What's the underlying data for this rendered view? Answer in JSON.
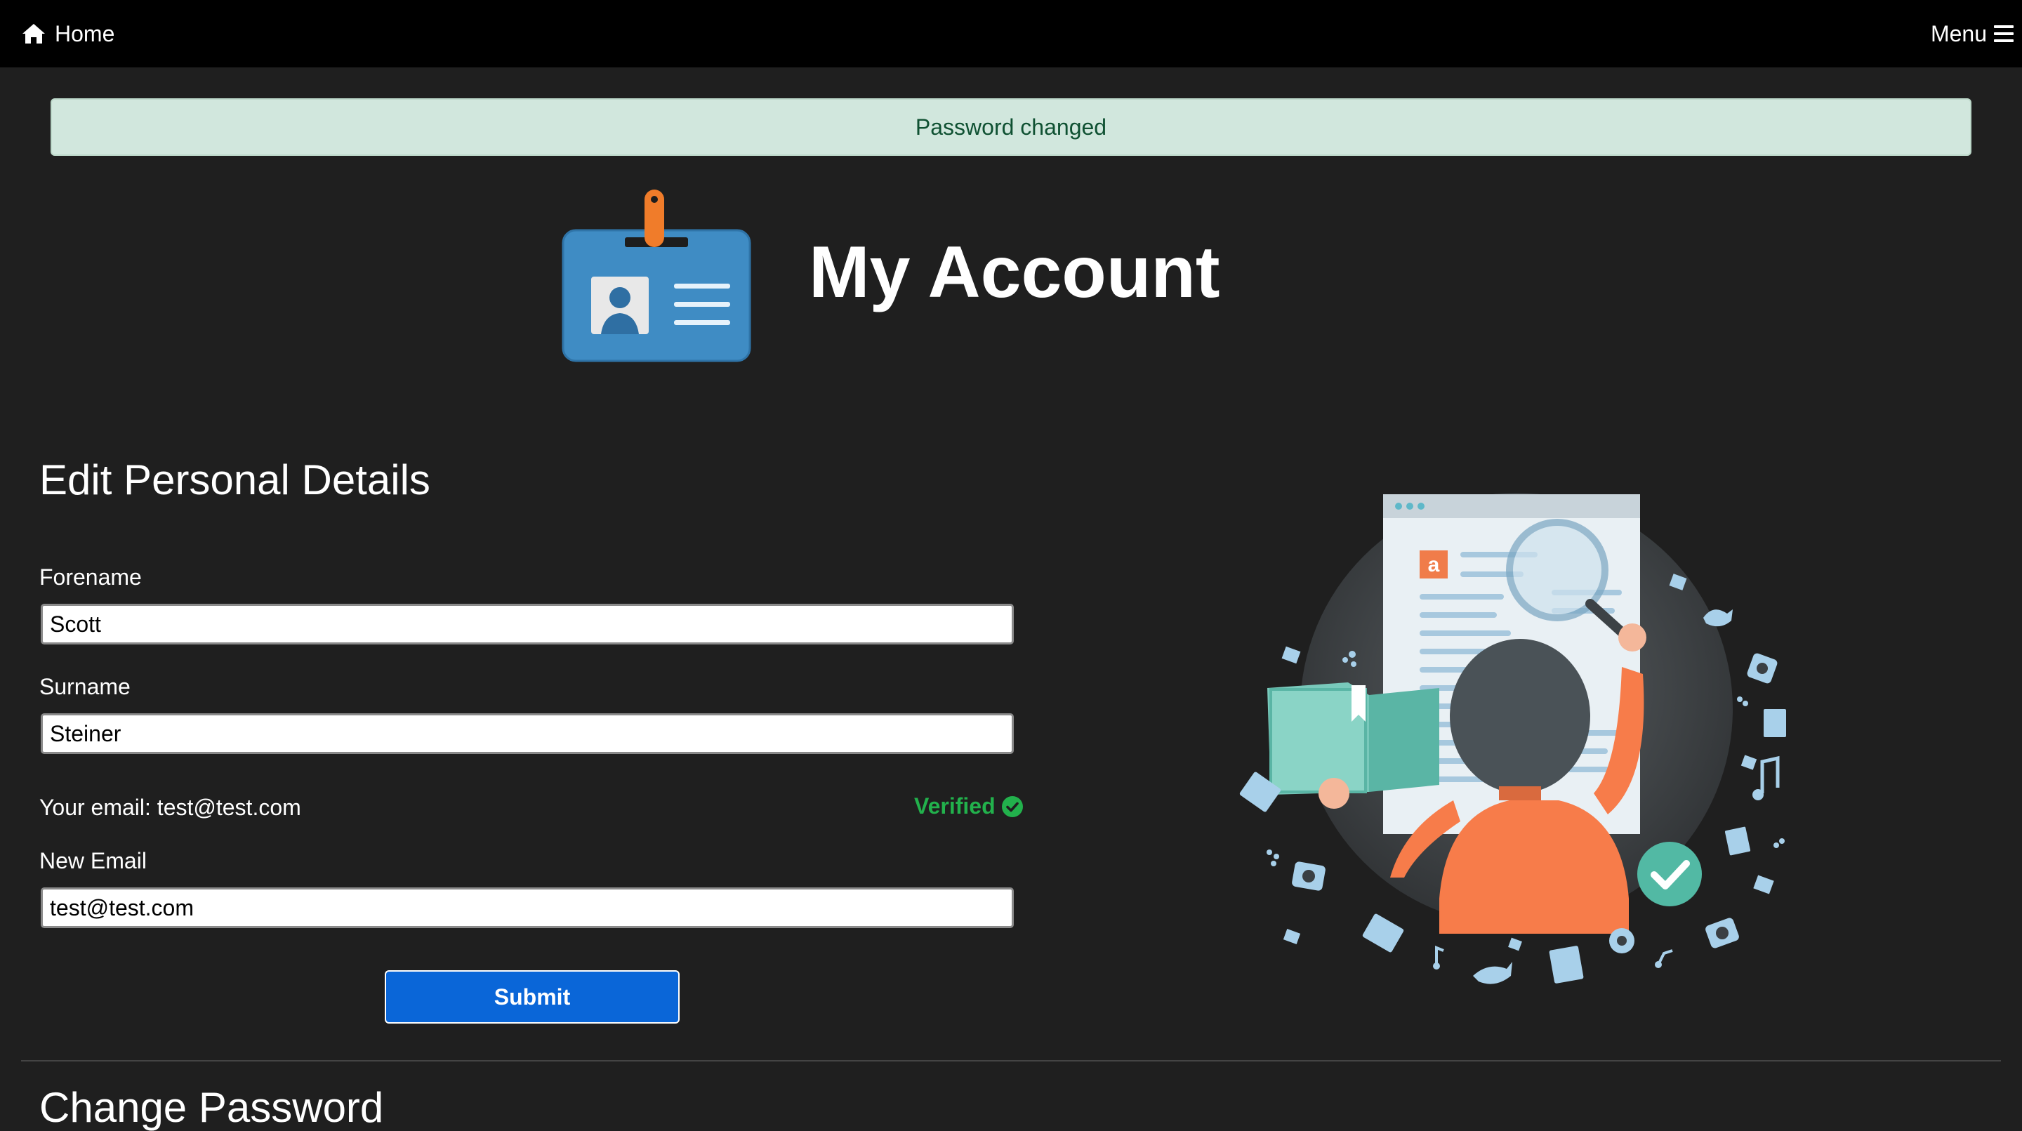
{
  "nav": {
    "home_label": "Home",
    "menu_label": "Menu"
  },
  "alert": {
    "message": "Password changed"
  },
  "header": {
    "title": "My Account"
  },
  "personal_details": {
    "section_title": "Edit Personal Details",
    "forename_label": "Forename",
    "forename_value": "Scott",
    "surname_label": "Surname",
    "surname_value": "Steiner",
    "email_text": "Your email: test@test.com",
    "verified_label": "Verified",
    "new_email_label": "New Email",
    "new_email_value": "test@test.com",
    "submit_label": "Submit"
  },
  "change_password": {
    "section_title": "Change Password"
  },
  "icons": {
    "home": "home-icon",
    "menu": "hamburger-menu-icon",
    "verified": "check-circle-icon",
    "badge": "id-badge-icon"
  },
  "colors": {
    "alert_bg": "#d1e7dd",
    "alert_text": "#0f5132",
    "verified": "#22b14c",
    "submit_bg": "#0a66d8",
    "page_bg": "#1f1f1f",
    "navbar_bg": "#000000"
  }
}
